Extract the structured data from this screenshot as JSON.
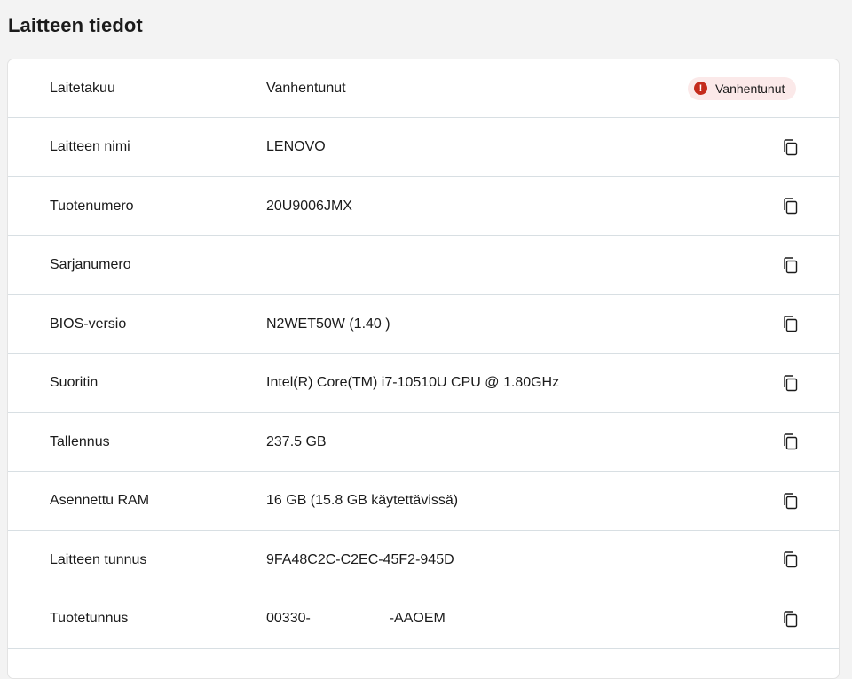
{
  "page": {
    "title": "Laitteen tiedot"
  },
  "warranty": {
    "label": "Laitetakuu",
    "value": "Vanhentunut",
    "badge_text": "Vanhentunut",
    "badge_icon": "!",
    "badge_color": "#c42b1c"
  },
  "rows": [
    {
      "label": "Laitteen nimi",
      "value": "LENOVO"
    },
    {
      "label": "Tuotenumero",
      "value": "20U9006JMX"
    },
    {
      "label": "Sarjanumero",
      "value": ""
    },
    {
      "label": "BIOS-versio",
      "value": "N2WET50W (1.40 )"
    },
    {
      "label": "Suoritin",
      "value": "Intel(R) Core(TM) i7-10510U CPU @ 1.80GHz"
    },
    {
      "label": "Tallennus",
      "value": "237.5 GB"
    },
    {
      "label": "Asennettu RAM",
      "value": "16 GB (15.8 GB käytettävissä)"
    },
    {
      "label": "Laitteen tunnus",
      "value": "9FA48C2C-C2EC-45F2-945D"
    },
    {
      "label": "Tuotetunnus",
      "value": "00330-                    -AAOEM"
    }
  ],
  "icons": {
    "copy": "copy-icon",
    "error": "error-icon"
  }
}
